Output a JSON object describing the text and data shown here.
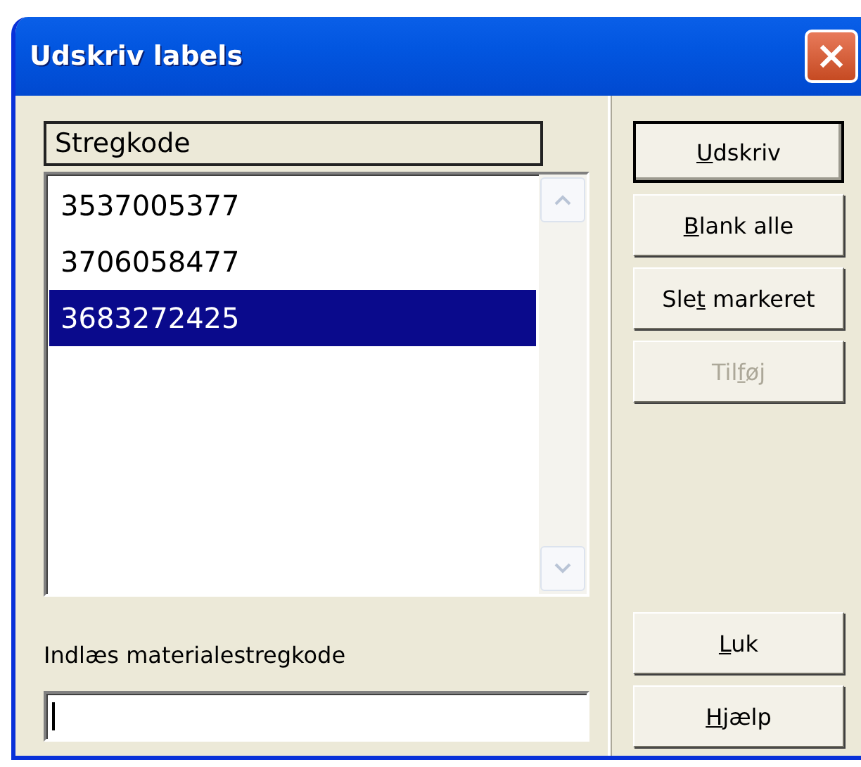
{
  "window": {
    "title": "Udskriv labels"
  },
  "list": {
    "header": "Stregkode",
    "rows": [
      {
        "text": "3537005377",
        "selected": false
      },
      {
        "text": "3706058477",
        "selected": false
      },
      {
        "text": "3683272425",
        "selected": true
      }
    ]
  },
  "input": {
    "label": "Indlæs materialestregkode",
    "focused": true
  },
  "buttons_top": [
    {
      "underlined": "U",
      "text_after": "dskriv",
      "default": true,
      "disabled": false
    },
    {
      "underlined": "B",
      "text_after": "lank alle",
      "default": false,
      "disabled": false
    },
    {
      "text_before": "Sle",
      "underlined": "t",
      "text_after": " markeret",
      "default": false,
      "disabled": false
    },
    {
      "text_before": "Til",
      "underlined": "f",
      "text_after": "øj",
      "default": false,
      "disabled": true
    }
  ],
  "buttons_bottom": [
    {
      "underlined": "L",
      "text_after": "uk",
      "default": false,
      "disabled": false
    },
    {
      "underlined": "H",
      "text_after": "jælp",
      "default": false,
      "disabled": false
    }
  ]
}
